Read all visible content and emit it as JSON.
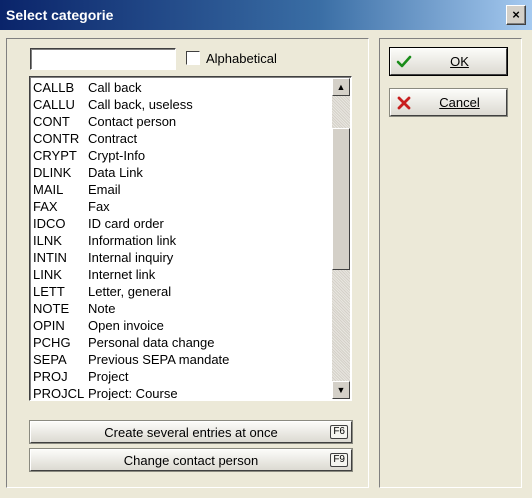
{
  "window": {
    "title": "Select categorie",
    "close_glyph": "×"
  },
  "search": {
    "value": ""
  },
  "alphabetical": {
    "label": "Alphabetical",
    "checked": false
  },
  "categories": [
    {
      "code": "CALLB",
      "label": "Call back"
    },
    {
      "code": "CALLU",
      "label": "Call back, useless"
    },
    {
      "code": "CONT",
      "label": "Contact person"
    },
    {
      "code": "CONTR",
      "label": "Contract"
    },
    {
      "code": "CRYPT",
      "label": "Crypt-Info"
    },
    {
      "code": "DLINK",
      "label": "Data Link"
    },
    {
      "code": "MAIL",
      "label": "Email"
    },
    {
      "code": "FAX",
      "label": "Fax"
    },
    {
      "code": "IDCO",
      "label": "ID card order"
    },
    {
      "code": "ILNK",
      "label": "Information link"
    },
    {
      "code": "INTIN",
      "label": "Internal inquiry"
    },
    {
      "code": "LINK",
      "label": "Internet link"
    },
    {
      "code": "LETT",
      "label": "Letter, general"
    },
    {
      "code": "NOTE",
      "label": "Note"
    },
    {
      "code": "OPIN",
      "label": "Open invoice"
    },
    {
      "code": "PCHG",
      "label": "Personal data change"
    },
    {
      "code": "SEPA",
      "label": "Previous SEPA mandate"
    },
    {
      "code": "PROJ",
      "label": "Project"
    },
    {
      "code": "PROJCL",
      "label": "Project: Course"
    }
  ],
  "buttons": {
    "several": {
      "label": "Create several entries at once",
      "hotkey": "F6"
    },
    "change_contact": {
      "label": "Change contact person",
      "hotkey": "F9"
    },
    "ok": {
      "label": "OK",
      "icon": "check-icon"
    },
    "cancel": {
      "label": "Cancel",
      "icon": "x-icon"
    }
  },
  "colors": {
    "title_bg": "#0a246a",
    "dialog_bg": "#ece9d8",
    "ok_icon": "#1a8c1a",
    "cancel_icon": "#c81e1e"
  }
}
